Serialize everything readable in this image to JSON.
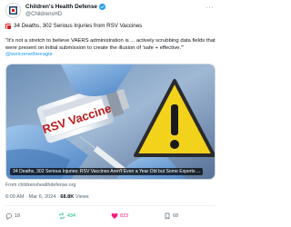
{
  "account": {
    "display_name": "Children's Health Defense",
    "handle": "@ChildrensHD"
  },
  "tweet": {
    "headline": "34 Deaths, 302 Serious Injuries from RSV Vaccines",
    "quote_text": "\"It's not a stretch to believe VAERS administration is ... actively scrubbing data fields that were present on initial submission to create the illusion of 'safe + effective.'\"",
    "mention": "@welcometheeagle"
  },
  "media": {
    "vial_label": "RSV Vaccine",
    "caption": "34 Deaths, 302 Serious Injuries: RSV Vaccines Aren't Even a Year Old but Some Experts ..."
  },
  "source": "From childrenshealthdefense.org",
  "meta": {
    "time": "6:00 AM",
    "date": "Mar 6, 2024",
    "separator": "·",
    "views_count": "68.8K",
    "views_label": "Views"
  },
  "actions": {
    "replies": "18",
    "reposts": "434",
    "likes": "823",
    "bookmarks": "68"
  },
  "colors": {
    "accent": "#1d9bf0",
    "repost": "#00ba7c",
    "like": "#f91880",
    "warning": "#f2d21b"
  }
}
